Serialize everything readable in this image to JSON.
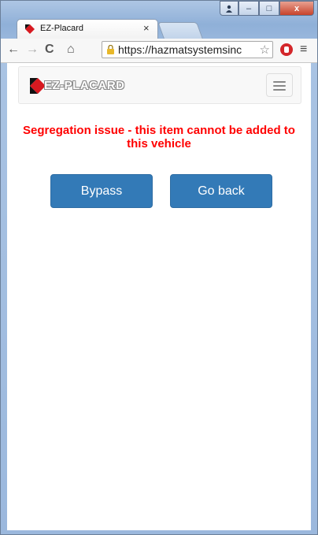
{
  "browser": {
    "tab_title": "EZ-Placard",
    "tab_close": "×",
    "url": "https://hazmatsystemsinc",
    "window_buttons": {
      "minimize": "–",
      "maximize": "□",
      "close": "x"
    }
  },
  "page": {
    "brand": "EZ-PLACARD",
    "message": "Segregation issue - this item cannot be added to this vehicle",
    "buttons": {
      "bypass": "Bypass",
      "go_back": "Go back"
    }
  },
  "colors": {
    "message": "#ff0000",
    "button": "#337ab7"
  }
}
